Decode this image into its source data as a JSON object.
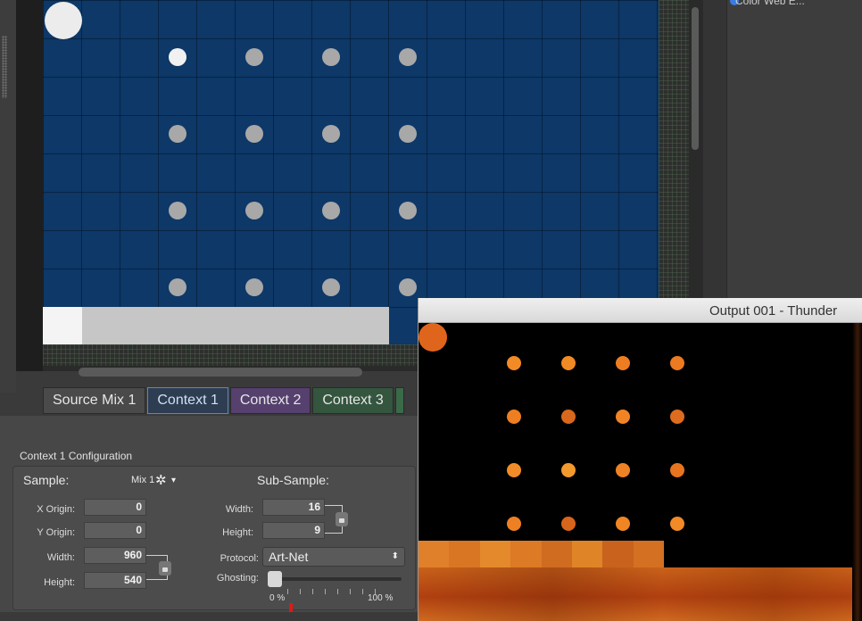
{
  "right_panel": {
    "cut_text": "Color Web E..."
  },
  "tabs": [
    {
      "label": "Source Mix 1"
    },
    {
      "label": "Context 1"
    },
    {
      "label": "Context 2"
    },
    {
      "label": "Context 3"
    }
  ],
  "config": {
    "title": "Context 1 Configuration",
    "sample_label": "Sample:",
    "sample_value": "Mix 1",
    "subsample_label": "Sub-Sample:",
    "x_origin_label": "X Origin:",
    "x_origin": "0",
    "y_origin_label": "Y Origin:",
    "y_origin": "0",
    "width_label": "Width:",
    "width": "960",
    "height_label": "Height:",
    "height": "540",
    "sub_width_label": "Width:",
    "sub_width": "16",
    "sub_height_label": "Height:",
    "sub_height": "9",
    "protocol_label": "Protocol:",
    "protocol": "Art-Net",
    "ghosting_label": "Ghosting:",
    "ghosting_min": "0 %",
    "ghosting_max": "100 %",
    "ghosting_level": 0
  },
  "output_window": {
    "title": "Output 001 - Thunder"
  },
  "colors": {
    "stage_blue": "#0d3868",
    "accent_orange": "#f08a24",
    "context1_tab": "#5a8ac0",
    "context2_tab": "#55406e",
    "context3_tab": "#34553e"
  },
  "icons": [
    "gear-icon",
    "chevron-down-icon",
    "lock-icon",
    "select-arrows-icon"
  ]
}
